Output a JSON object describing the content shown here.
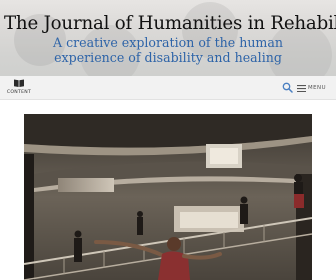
{
  "header": {
    "site_title": "The Journal of Humanities in Rehabilitation",
    "tagline_line1": "A creative exploration of the human",
    "tagline_line2": "experience of disability and healing"
  },
  "nav": {
    "content_label": "CONTENT",
    "menu_label": "MENU"
  },
  "icons": {
    "content": "book-icon",
    "search": "search-icon",
    "menu": "hamburger-icon"
  },
  "colors": {
    "title": "#111111",
    "tagline": "#2e64a8",
    "nav_background": "#f2f2f2",
    "accent_icon": "#4a7fc1"
  }
}
